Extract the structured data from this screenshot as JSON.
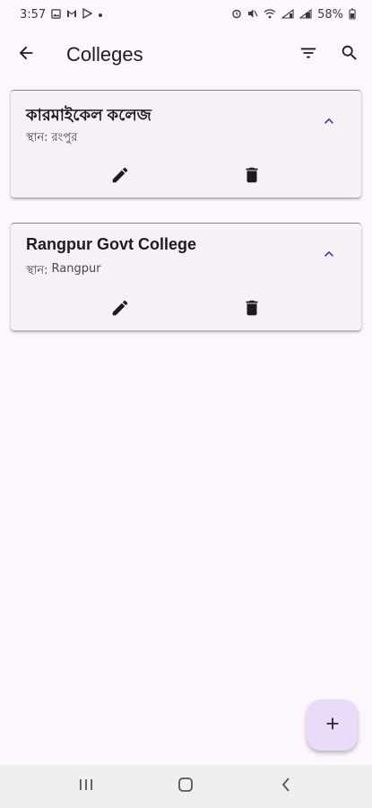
{
  "status_bar": {
    "time": "3:57",
    "battery": "58%",
    "left_icons": [
      "gallery-icon",
      "gmail-icon",
      "play-store-icon",
      "dot-icon"
    ],
    "right_icons": [
      "alarm-icon",
      "mute-icon",
      "wifi-icon",
      "signal-icon",
      "signal-icon"
    ]
  },
  "app_bar": {
    "title": "Colleges"
  },
  "colleges": [
    {
      "name": "কারমাইকেল কলেজ",
      "location_label": "স্থান:",
      "location": "রংপুর"
    },
    {
      "name": "Rangpur Govt College",
      "location_label": "স্থান:",
      "location": "Rangpur"
    }
  ],
  "colors": {
    "background": "#fdf6fd",
    "card": "#f6f0f7",
    "accent": "#4b3fa0",
    "fab": "#e9dcfb"
  }
}
